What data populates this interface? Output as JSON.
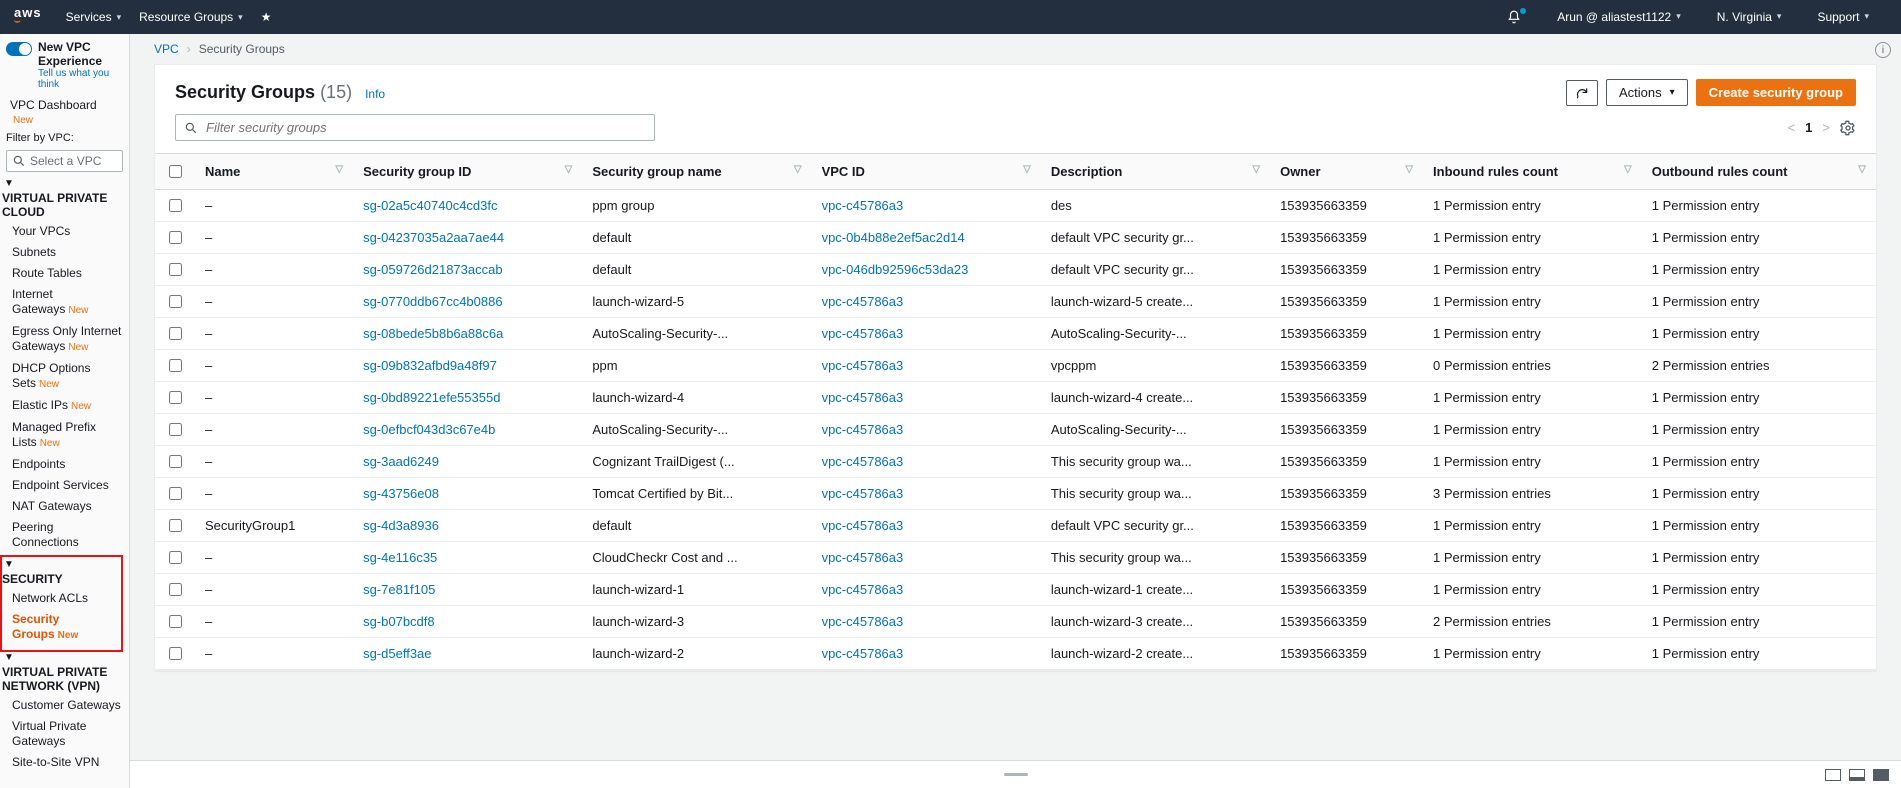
{
  "topnav": {
    "services": "Services",
    "resource_groups": "Resource Groups",
    "user": "Arun @ aliastest1122",
    "region": "N. Virginia",
    "support": "Support"
  },
  "sidebar": {
    "experience_title": "New VPC Experience",
    "experience_sub": "Tell us what you think",
    "dashboard": "VPC Dashboard",
    "filter_label": "Filter by VPC:",
    "filter_placeholder": "Select a VPC",
    "section1_title": "VIRTUAL PRIVATE CLOUD",
    "section1_items": [
      {
        "label": "Your VPCs",
        "new": false
      },
      {
        "label": "Subnets",
        "new": false
      },
      {
        "label": "Route Tables",
        "new": false
      },
      {
        "label": "Internet Gateways",
        "new": true
      },
      {
        "label": "Egress Only Internet Gateways",
        "new": true
      },
      {
        "label": "DHCP Options Sets",
        "new": true
      },
      {
        "label": "Elastic IPs",
        "new": true
      },
      {
        "label": "Managed Prefix Lists",
        "new": true
      },
      {
        "label": "Endpoints",
        "new": false
      },
      {
        "label": "Endpoint Services",
        "new": false
      },
      {
        "label": "NAT Gateways",
        "new": false
      },
      {
        "label": "Peering Connections",
        "new": false
      }
    ],
    "section2_title": "SECURITY",
    "section2_items": [
      {
        "label": "Network ACLs",
        "new": false,
        "active": false
      },
      {
        "label": "Security Groups",
        "new": true,
        "active": true
      }
    ],
    "section3_title": "VIRTUAL PRIVATE NETWORK (VPN)",
    "section3_items": [
      {
        "label": "Customer Gateways",
        "new": false
      },
      {
        "label": "Virtual Private Gateways",
        "new": false
      },
      {
        "label": "Site-to-Site VPN",
        "new": false
      }
    ],
    "new_badge": "New"
  },
  "breadcrumb": {
    "root": "VPC",
    "current": "Security Groups"
  },
  "panel": {
    "title": "Security Groups",
    "count": "(15)",
    "info": "Info",
    "actions_label": "Actions",
    "create_label": "Create security group",
    "filter_placeholder": "Filter security groups",
    "page": "1"
  },
  "table": {
    "headers": [
      "Name",
      "Security group ID",
      "Security group name",
      "VPC ID",
      "Description",
      "Owner",
      "Inbound rules count",
      "Outbound rules count"
    ],
    "rows": [
      {
        "name": "–",
        "sgid": "sg-02a5c40740c4cd3fc",
        "sgname": "ppm group",
        "vpc": "vpc-c45786a3",
        "desc": "des",
        "owner": "153935663359",
        "in": "1 Permission entry",
        "out": "1 Permission entry"
      },
      {
        "name": "–",
        "sgid": "sg-04237035a2aa7ae44",
        "sgname": "default",
        "vpc": "vpc-0b4b88e2ef5ac2d14",
        "desc": "default VPC security gr...",
        "owner": "153935663359",
        "in": "1 Permission entry",
        "out": "1 Permission entry"
      },
      {
        "name": "–",
        "sgid": "sg-059726d21873accab",
        "sgname": "default",
        "vpc": "vpc-046db92596c53da23",
        "desc": "default VPC security gr...",
        "owner": "153935663359",
        "in": "1 Permission entry",
        "out": "1 Permission entry"
      },
      {
        "name": "–",
        "sgid": "sg-0770ddb67cc4b0886",
        "sgname": "launch-wizard-5",
        "vpc": "vpc-c45786a3",
        "desc": "launch-wizard-5 create...",
        "owner": "153935663359",
        "in": "1 Permission entry",
        "out": "1 Permission entry"
      },
      {
        "name": "–",
        "sgid": "sg-08bede5b8b6a88c6a",
        "sgname": "AutoScaling-Security-...",
        "vpc": "vpc-c45786a3",
        "desc": "AutoScaling-Security-...",
        "owner": "153935663359",
        "in": "1 Permission entry",
        "out": "1 Permission entry"
      },
      {
        "name": "–",
        "sgid": "sg-09b832afbd9a48f97",
        "sgname": "ppm",
        "vpc": "vpc-c45786a3",
        "desc": "vpcppm",
        "owner": "153935663359",
        "in": "0 Permission entries",
        "out": "2 Permission entries"
      },
      {
        "name": "–",
        "sgid": "sg-0bd89221efe55355d",
        "sgname": "launch-wizard-4",
        "vpc": "vpc-c45786a3",
        "desc": "launch-wizard-4 create...",
        "owner": "153935663359",
        "in": "1 Permission entry",
        "out": "1 Permission entry"
      },
      {
        "name": "–",
        "sgid": "sg-0efbcf043d3c67e4b",
        "sgname": "AutoScaling-Security-...",
        "vpc": "vpc-c45786a3",
        "desc": "AutoScaling-Security-...",
        "owner": "153935663359",
        "in": "1 Permission entry",
        "out": "1 Permission entry"
      },
      {
        "name": "–",
        "sgid": "sg-3aad6249",
        "sgname": "Cognizant TrailDigest (...",
        "vpc": "vpc-c45786a3",
        "desc": "This security group wa...",
        "owner": "153935663359",
        "in": "1 Permission entry",
        "out": "1 Permission entry"
      },
      {
        "name": "–",
        "sgid": "sg-43756e08",
        "sgname": "Tomcat Certified by Bit...",
        "vpc": "vpc-c45786a3",
        "desc": "This security group wa...",
        "owner": "153935663359",
        "in": "3 Permission entries",
        "out": "1 Permission entry"
      },
      {
        "name": "SecurityGroup1",
        "sgid": "sg-4d3a8936",
        "sgname": "default",
        "vpc": "vpc-c45786a3",
        "desc": "default VPC security gr...",
        "owner": "153935663359",
        "in": "1 Permission entry",
        "out": "1 Permission entry"
      },
      {
        "name": "–",
        "sgid": "sg-4e116c35",
        "sgname": "CloudCheckr Cost and ...",
        "vpc": "vpc-c45786a3",
        "desc": "This security group wa...",
        "owner": "153935663359",
        "in": "1 Permission entry",
        "out": "1 Permission entry"
      },
      {
        "name": "–",
        "sgid": "sg-7e81f105",
        "sgname": "launch-wizard-1",
        "vpc": "vpc-c45786a3",
        "desc": "launch-wizard-1 create...",
        "owner": "153935663359",
        "in": "1 Permission entry",
        "out": "1 Permission entry"
      },
      {
        "name": "–",
        "sgid": "sg-b07bcdf8",
        "sgname": "launch-wizard-3",
        "vpc": "vpc-c45786a3",
        "desc": "launch-wizard-3 create...",
        "owner": "153935663359",
        "in": "2 Permission entries",
        "out": "1 Permission entry"
      },
      {
        "name": "–",
        "sgid": "sg-d5eff3ae",
        "sgname": "launch-wizard-2",
        "vpc": "vpc-c45786a3",
        "desc": "launch-wizard-2 create...",
        "owner": "153935663359",
        "in": "1 Permission entry",
        "out": "1 Permission entry"
      }
    ]
  }
}
